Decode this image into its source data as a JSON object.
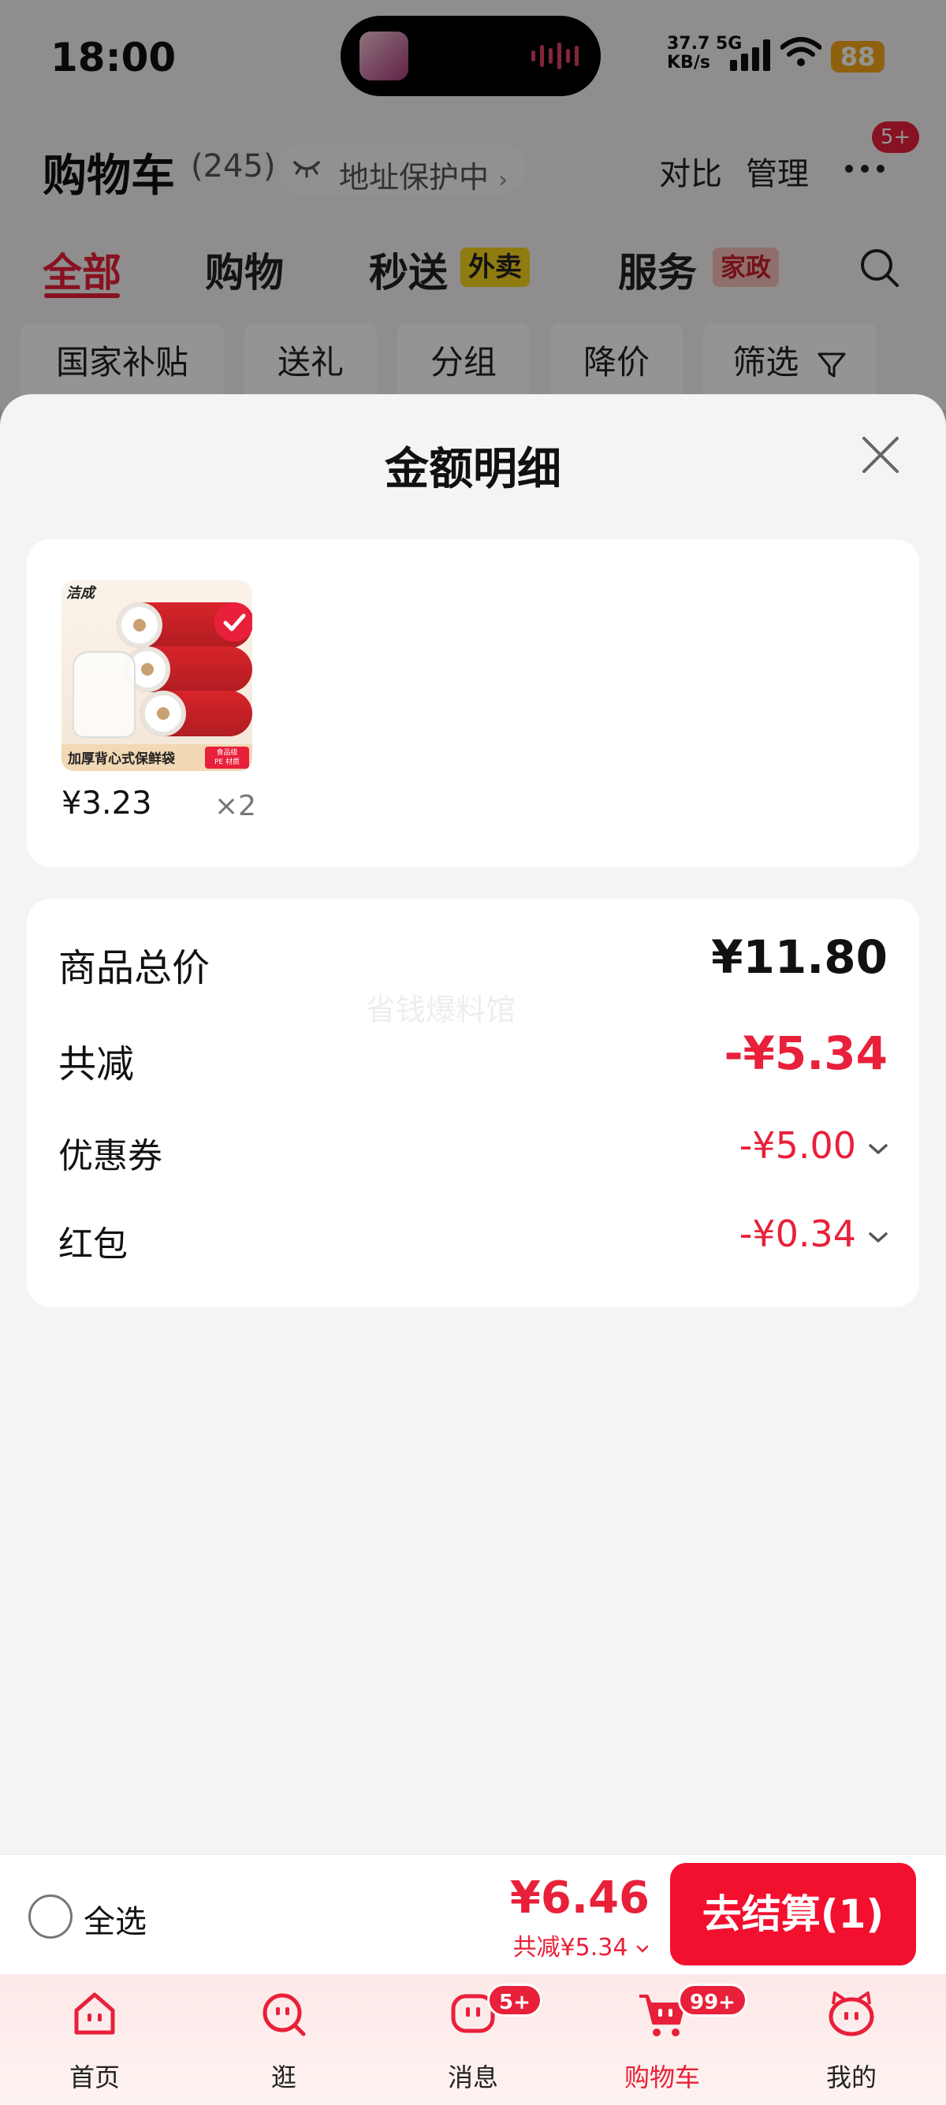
{
  "status_bar": {
    "time": "18:00",
    "net_speed_value": "37.7",
    "net_speed_unit": "KB/s",
    "network": "5G",
    "battery": "88"
  },
  "header": {
    "title": "购物车",
    "count": "(245)",
    "address": "地址保护中",
    "address_chevron": "›",
    "compare": "对比",
    "manage": "管理",
    "more_badge": "5+"
  },
  "tabs": [
    {
      "label": "全部"
    },
    {
      "label": "购物"
    },
    {
      "label": "秒送",
      "tag": "外卖"
    },
    {
      "label": "服务",
      "tag": "家政"
    }
  ],
  "filters": [
    "国家补贴",
    "送礼",
    "分组",
    "降价",
    "筛选"
  ],
  "sheet": {
    "title": "金额明细",
    "product": {
      "brand": "洁成",
      "label": "加厚背心式保鲜袋",
      "label_tag_line1": "食品级",
      "label_tag_line2": "PE 材质",
      "price": "¥3.23",
      "quantity": "×2"
    },
    "summary": {
      "total_label": "商品总价",
      "total_value": "¥11.80",
      "reduce_label": "共减",
      "reduce_value": "-¥5.34",
      "coupon_label": "优惠券",
      "coupon_value": "-¥5.00",
      "redpacket_label": "红包",
      "redpacket_value": "-¥0.34",
      "watermark": "省钱爆料馆"
    }
  },
  "checkout": {
    "select_all": "全选",
    "pay_price": "¥6.46",
    "pay_reduce": "共减¥5.34",
    "checkout_label": "去结算(1)"
  },
  "bottom_nav": [
    {
      "label": "首页",
      "badge": ""
    },
    {
      "label": "逛",
      "badge": ""
    },
    {
      "label": "消息",
      "badge": "5+"
    },
    {
      "label": "购物车",
      "badge": "99+"
    },
    {
      "label": "我的",
      "badge": ""
    }
  ],
  "colors": {
    "accent": "#e8203a",
    "sheet_bg": "#f4f4f4",
    "card_bg": "#ffffff"
  }
}
